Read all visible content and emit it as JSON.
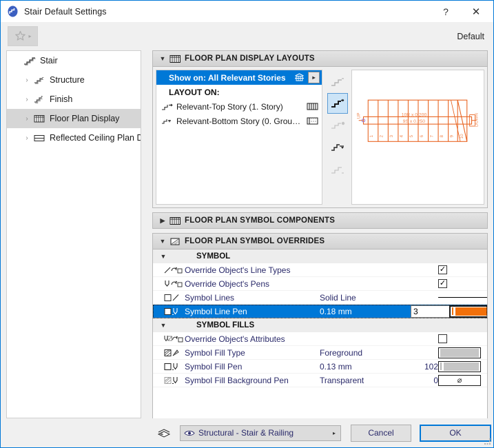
{
  "window": {
    "title": "Stair Default Settings",
    "app_icon": "stair-app-icon",
    "help_label": "?",
    "close_label": "✕",
    "accent_color": "#0078d7",
    "pen_color": "#f2700a"
  },
  "toolbar": {
    "favorites_icon": "star-icon",
    "favorites_arrow": "▸",
    "default_label": "Default"
  },
  "sidebar": {
    "items": [
      {
        "label": "Stair",
        "icon": "stair-icon",
        "chevron": "ⱟ",
        "level": 0,
        "selected": false
      },
      {
        "label": "Structure",
        "icon": "structure-icon",
        "chevron": "›",
        "level": 1,
        "selected": false
      },
      {
        "label": "Finish",
        "icon": "finish-icon",
        "chevron": "›",
        "level": 1,
        "selected": false
      },
      {
        "label": "Floor Plan Display",
        "icon": "floor-plan-display-icon",
        "chevron": "›",
        "level": 1,
        "selected": true
      },
      {
        "label": "Reflected Ceiling Plan Di",
        "icon": "reflected-ceiling-icon",
        "chevron": "›",
        "level": 1,
        "selected": false
      }
    ],
    "scroll_left": "‹",
    "scroll_right": "›"
  },
  "sections": {
    "layouts": {
      "title": "FLOOR PLAN DISPLAY LAYOUTS",
      "icon": "floor-plan-layouts-icon",
      "chevron": "▼",
      "expanded": true,
      "show_on": {
        "label": "Show on: All Relevant Stories",
        "icon": "stories-icon",
        "arrow": "▸"
      },
      "layout_on_label": "LAYOUT ON:",
      "rows": [
        {
          "label": "Relevant-Top Story (1. Story)",
          "icon": "top-story-icon",
          "right_icon": "hatch-full-icon"
        },
        {
          "label": "Relevant-Bottom Story (0. Grou…",
          "icon": "bottom-story-icon",
          "right_icon": "hatch-partial-icon"
        }
      ],
      "view_buttons": [
        {
          "name": "view-above-icon",
          "active": false
        },
        {
          "name": "view-home-story-icon",
          "active": true
        },
        {
          "name": "view-below-icon",
          "active": false
        },
        {
          "name": "view-bottom-icon",
          "active": false
        },
        {
          "name": "view-custom-icon",
          "active": false
        }
      ],
      "preview": {
        "name": "stair-plan-preview",
        "riser_label": "10R x 0.200",
        "tread_label": "9S x 0.250",
        "up_label": "UP",
        "down_label": "DOWN",
        "tread_numbers": [
          "1",
          "2",
          "3",
          "4",
          "5",
          "6",
          "7",
          "8",
          "9",
          "10"
        ]
      }
    },
    "components": {
      "title": "FLOOR PLAN SYMBOL COMPONENTS",
      "icon": "symbol-components-icon",
      "chevron": "▶",
      "expanded": false
    },
    "overrides": {
      "title": "FLOOR PLAN SYMBOL OVERRIDES",
      "icon": "symbol-overrides-icon",
      "chevron": "▼",
      "expanded": true,
      "groups": [
        {
          "title": "SYMBOL",
          "chevron": "▼",
          "rows": [
            {
              "label": "Override Object's Line Types",
              "icon": "override-line-types-icon",
              "value": "",
              "number": "",
              "control": "checkbox",
              "checked": true,
              "selected": false
            },
            {
              "label": "Override Object's Pens",
              "icon": "override-pens-icon",
              "value": "",
              "number": "",
              "control": "checkbox",
              "checked": true,
              "selected": false
            },
            {
              "label": "Symbol Lines",
              "icon": "symbol-lines-icon",
              "value": "Solid Line",
              "number": "",
              "control": "line-preview",
              "checked": false,
              "selected": false
            },
            {
              "label": "Symbol Line Pen",
              "icon": "symbol-line-pen-icon",
              "value": "0.18 mm",
              "number": "3",
              "control": "pen-editor",
              "checked": false,
              "selected": true
            }
          ]
        },
        {
          "title": "SYMBOL FILLS",
          "chevron": "▼",
          "rows": [
            {
              "label": "Override Object's Attributes",
              "icon": "override-attributes-icon",
              "value": "",
              "number": "",
              "control": "checkbox",
              "checked": false,
              "selected": false
            },
            {
              "label": "Symbol Fill Type",
              "icon": "symbol-fill-type-icon",
              "value": "Foreground",
              "number": "",
              "control": "swatch-solid",
              "checked": false,
              "selected": false
            },
            {
              "label": "Symbol Fill Pen",
              "icon": "symbol-fill-pen-icon",
              "value": "0.13 mm",
              "number": "102",
              "control": "swatch-pen",
              "checked": false,
              "selected": false
            },
            {
              "label": "Symbol Fill Background Pen",
              "icon": "symbol-fill-bg-pen-icon",
              "value": "Transparent",
              "number": "0",
              "control": "swatch-transparent",
              "transparent_glyph": "⌀",
              "checked": false,
              "selected": false
            }
          ]
        }
      ]
    }
  },
  "footer": {
    "layers_icon": "layers-icon",
    "layer_combo": {
      "label": "Structural - Stair & Railing",
      "icon": "eye-icon",
      "arrow": "▸"
    },
    "cancel_label": "Cancel",
    "ok_label": "OK"
  }
}
